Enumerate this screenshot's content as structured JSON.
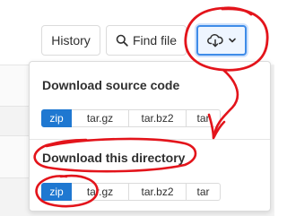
{
  "toolbar": {
    "history_label": "History",
    "find_file_label": "Find file",
    "download_icon": "cloud-download-icon",
    "chevron_icon": "chevron-down-icon"
  },
  "dropdown": {
    "source_code": {
      "title": "Download source code",
      "formats": [
        "zip",
        "tar.gz",
        "tar.bz2",
        "tar"
      ],
      "active": "zip"
    },
    "directory": {
      "title": "Download this directory",
      "formats": [
        "zip",
        "tar.gz",
        "tar.bz2",
        "tar"
      ],
      "active": "zip"
    }
  },
  "colors": {
    "accent": "#1f78d1",
    "annotation": "#e3141b",
    "focus_ring": "#3f8ce8"
  }
}
